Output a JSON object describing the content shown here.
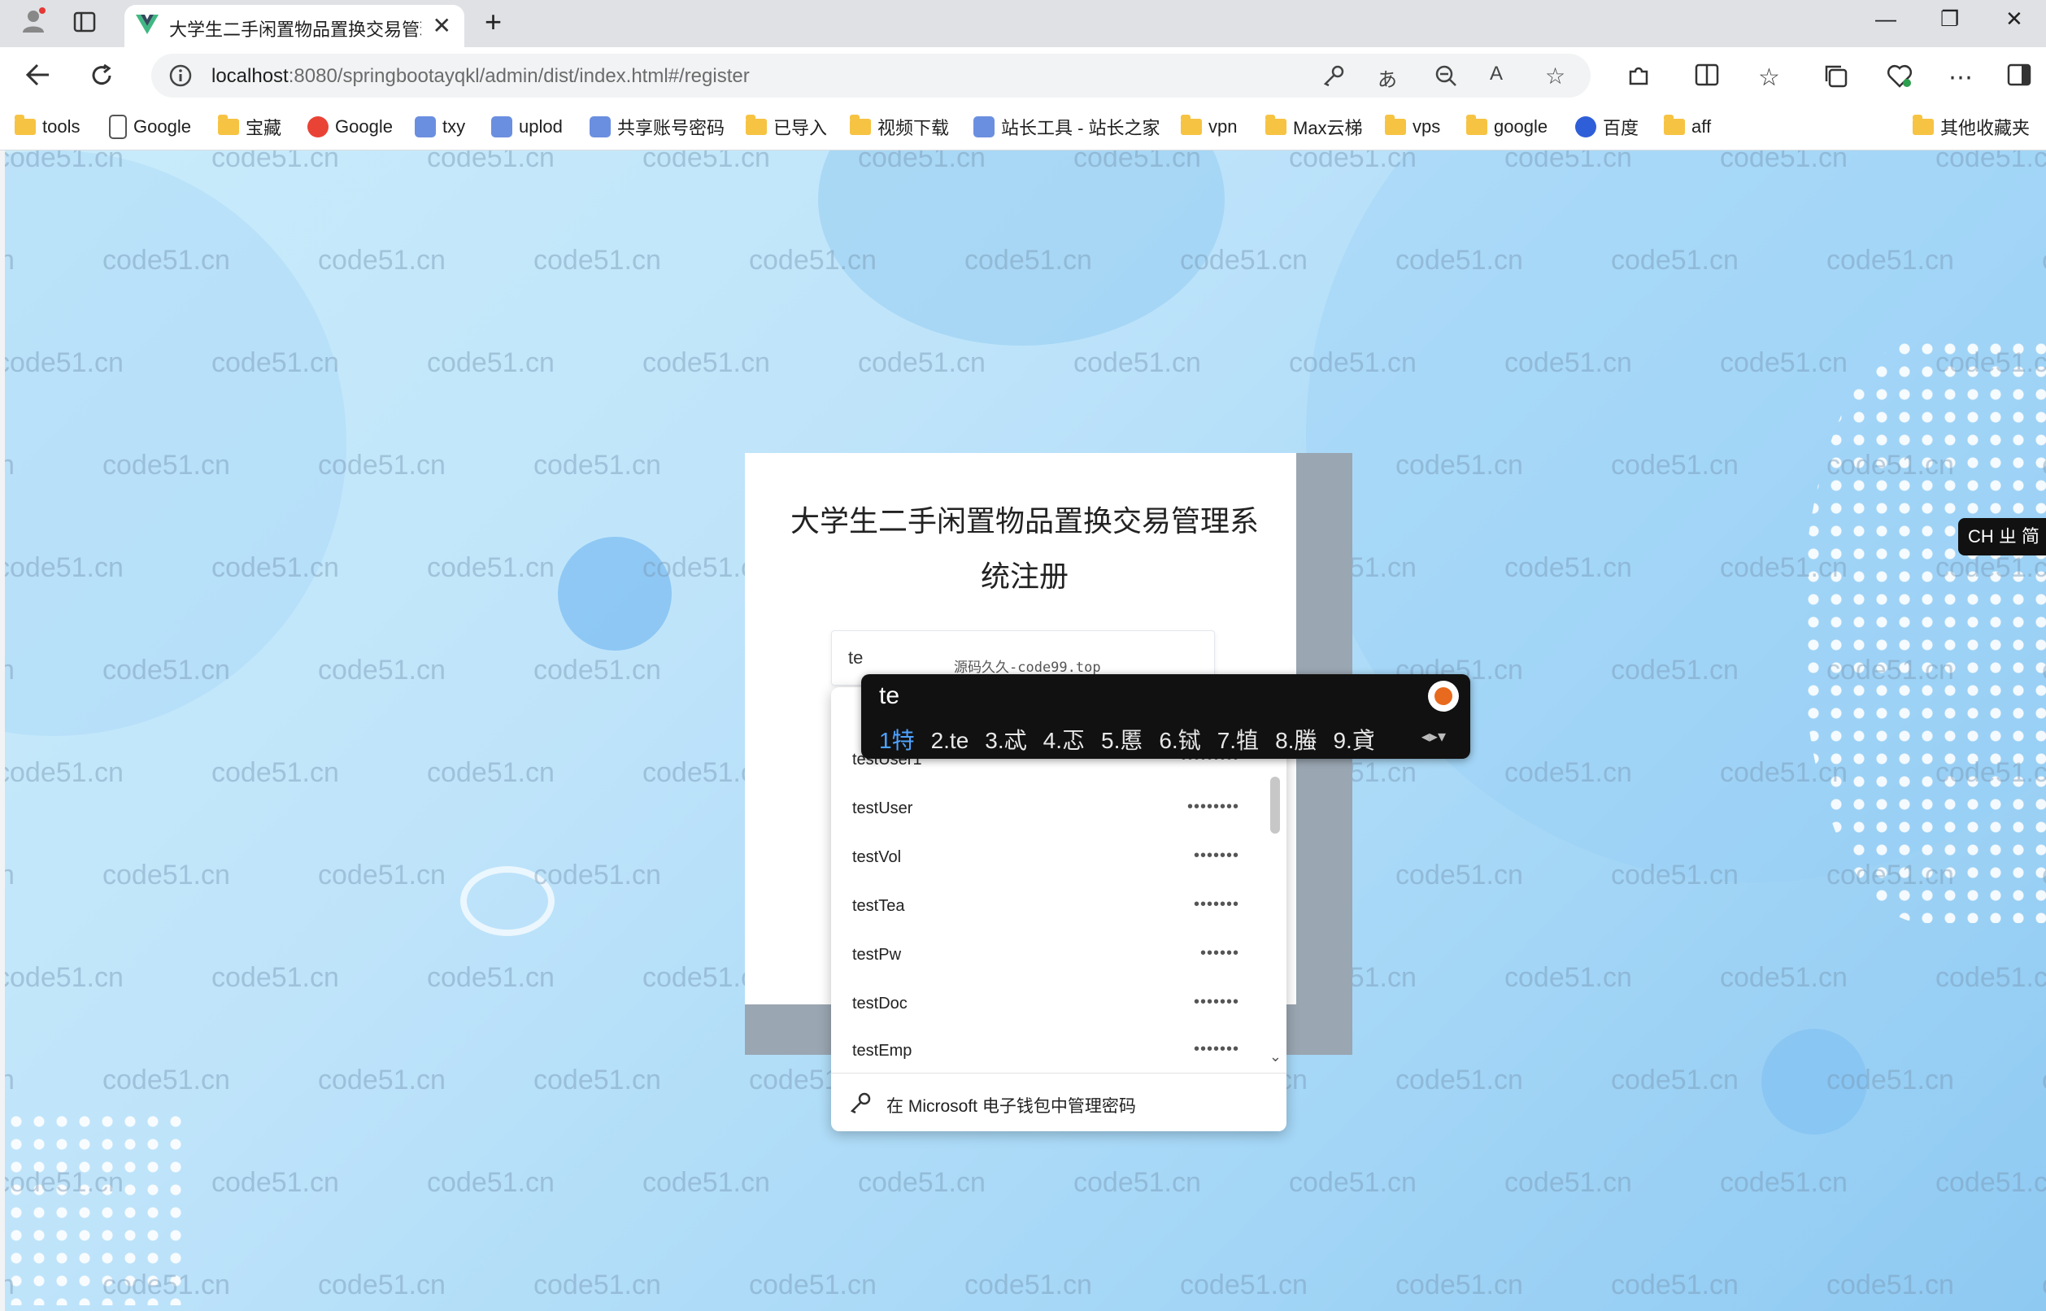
{
  "browser": {
    "tab_title": "大学生二手闲置物品置换交易管理",
    "tab_close": "✕",
    "new_tab": "+",
    "address": {
      "host": "localhost",
      "rest": ":8080/springbootayqkl/admin/dist/index.html#/register"
    },
    "window_controls": {
      "minimize": "—",
      "restore": "❐",
      "close": "✕"
    },
    "bookmarks": [
      {
        "label": "tools",
        "icon": "folder-icon"
      },
      {
        "label": "Google",
        "icon": "page-icon"
      },
      {
        "label": "宝藏",
        "icon": "folder-icon"
      },
      {
        "label": "Google",
        "icon": "google-icon"
      },
      {
        "label": "txy",
        "icon": "cloud-icon"
      },
      {
        "label": "uplod",
        "icon": "link-icon"
      },
      {
        "label": "共享账号密码",
        "icon": "app-icon"
      },
      {
        "label": "已导入",
        "icon": "folder-icon"
      },
      {
        "label": "视频下载",
        "icon": "folder-icon"
      },
      {
        "label": "站长工具 - 站长之家",
        "icon": "site-icon"
      },
      {
        "label": "vpn",
        "icon": "folder-icon"
      },
      {
        "label": "Max云梯",
        "icon": "folder-icon"
      },
      {
        "label": "vps",
        "icon": "folder-icon"
      },
      {
        "label": "google",
        "icon": "folder-icon"
      },
      {
        "label": "百度",
        "icon": "baidu-icon"
      },
      {
        "label": "aff",
        "icon": "folder-icon"
      }
    ],
    "other_bookmarks": "其他收藏夹"
  },
  "page": {
    "watermark": "code51.cn",
    "title_line1": "大学生二手闲置物品置换交易管理系",
    "title_line2": "统注册",
    "username_value": "te",
    "input_hint": "源码久久-code99.top"
  },
  "autofill": {
    "items": [
      {
        "user": "testUser1",
        "pass": "•••••••••"
      },
      {
        "user": "testUser",
        "pass": "••••••••"
      },
      {
        "user": "testVol",
        "pass": "•••••••"
      },
      {
        "user": "testTea",
        "pass": "•••••••"
      },
      {
        "user": "testPw",
        "pass": "••••••"
      },
      {
        "user": "testDoc",
        "pass": "•••••••"
      },
      {
        "user": "testEmp",
        "pass": "•••••••"
      }
    ],
    "footer": "在 Microsoft 电子钱包中管理密码"
  },
  "ime": {
    "input": "te",
    "candidates": [
      "1特",
      "2.te",
      "3.忒",
      "4.忑",
      "5.慝",
      "6.铽",
      "7.犆",
      "8.螣",
      "9.貣"
    ],
    "badge": "CH ㄓ 简"
  },
  "colors": {
    "accent": "#4da3ff",
    "page_bg": "#bfe4fa"
  }
}
